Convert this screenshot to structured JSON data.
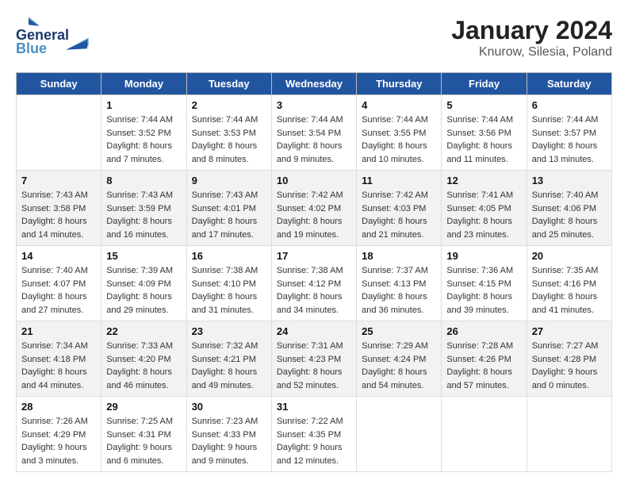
{
  "header": {
    "logo_line1": "General",
    "logo_line2": "Blue",
    "title": "January 2024",
    "subtitle": "Knurow, Silesia, Poland"
  },
  "weekdays": [
    "Sunday",
    "Monday",
    "Tuesday",
    "Wednesday",
    "Thursday",
    "Friday",
    "Saturday"
  ],
  "weeks": [
    [
      {
        "day": "",
        "detail": ""
      },
      {
        "day": "1",
        "detail": "Sunrise: 7:44 AM\nSunset: 3:52 PM\nDaylight: 8 hours\nand 7 minutes."
      },
      {
        "day": "2",
        "detail": "Sunrise: 7:44 AM\nSunset: 3:53 PM\nDaylight: 8 hours\nand 8 minutes."
      },
      {
        "day": "3",
        "detail": "Sunrise: 7:44 AM\nSunset: 3:54 PM\nDaylight: 8 hours\nand 9 minutes."
      },
      {
        "day": "4",
        "detail": "Sunrise: 7:44 AM\nSunset: 3:55 PM\nDaylight: 8 hours\nand 10 minutes."
      },
      {
        "day": "5",
        "detail": "Sunrise: 7:44 AM\nSunset: 3:56 PM\nDaylight: 8 hours\nand 11 minutes."
      },
      {
        "day": "6",
        "detail": "Sunrise: 7:44 AM\nSunset: 3:57 PM\nDaylight: 8 hours\nand 13 minutes."
      }
    ],
    [
      {
        "day": "7",
        "detail": "Sunrise: 7:43 AM\nSunset: 3:58 PM\nDaylight: 8 hours\nand 14 minutes."
      },
      {
        "day": "8",
        "detail": "Sunrise: 7:43 AM\nSunset: 3:59 PM\nDaylight: 8 hours\nand 16 minutes."
      },
      {
        "day": "9",
        "detail": "Sunrise: 7:43 AM\nSunset: 4:01 PM\nDaylight: 8 hours\nand 17 minutes."
      },
      {
        "day": "10",
        "detail": "Sunrise: 7:42 AM\nSunset: 4:02 PM\nDaylight: 8 hours\nand 19 minutes."
      },
      {
        "day": "11",
        "detail": "Sunrise: 7:42 AM\nSunset: 4:03 PM\nDaylight: 8 hours\nand 21 minutes."
      },
      {
        "day": "12",
        "detail": "Sunrise: 7:41 AM\nSunset: 4:05 PM\nDaylight: 8 hours\nand 23 minutes."
      },
      {
        "day": "13",
        "detail": "Sunrise: 7:40 AM\nSunset: 4:06 PM\nDaylight: 8 hours\nand 25 minutes."
      }
    ],
    [
      {
        "day": "14",
        "detail": "Sunrise: 7:40 AM\nSunset: 4:07 PM\nDaylight: 8 hours\nand 27 minutes."
      },
      {
        "day": "15",
        "detail": "Sunrise: 7:39 AM\nSunset: 4:09 PM\nDaylight: 8 hours\nand 29 minutes."
      },
      {
        "day": "16",
        "detail": "Sunrise: 7:38 AM\nSunset: 4:10 PM\nDaylight: 8 hours\nand 31 minutes."
      },
      {
        "day": "17",
        "detail": "Sunrise: 7:38 AM\nSunset: 4:12 PM\nDaylight: 8 hours\nand 34 minutes."
      },
      {
        "day": "18",
        "detail": "Sunrise: 7:37 AM\nSunset: 4:13 PM\nDaylight: 8 hours\nand 36 minutes."
      },
      {
        "day": "19",
        "detail": "Sunrise: 7:36 AM\nSunset: 4:15 PM\nDaylight: 8 hours\nand 39 minutes."
      },
      {
        "day": "20",
        "detail": "Sunrise: 7:35 AM\nSunset: 4:16 PM\nDaylight: 8 hours\nand 41 minutes."
      }
    ],
    [
      {
        "day": "21",
        "detail": "Sunrise: 7:34 AM\nSunset: 4:18 PM\nDaylight: 8 hours\nand 44 minutes."
      },
      {
        "day": "22",
        "detail": "Sunrise: 7:33 AM\nSunset: 4:20 PM\nDaylight: 8 hours\nand 46 minutes."
      },
      {
        "day": "23",
        "detail": "Sunrise: 7:32 AM\nSunset: 4:21 PM\nDaylight: 8 hours\nand 49 minutes."
      },
      {
        "day": "24",
        "detail": "Sunrise: 7:31 AM\nSunset: 4:23 PM\nDaylight: 8 hours\nand 52 minutes."
      },
      {
        "day": "25",
        "detail": "Sunrise: 7:29 AM\nSunset: 4:24 PM\nDaylight: 8 hours\nand 54 minutes."
      },
      {
        "day": "26",
        "detail": "Sunrise: 7:28 AM\nSunset: 4:26 PM\nDaylight: 8 hours\nand 57 minutes."
      },
      {
        "day": "27",
        "detail": "Sunrise: 7:27 AM\nSunset: 4:28 PM\nDaylight: 9 hours\nand 0 minutes."
      }
    ],
    [
      {
        "day": "28",
        "detail": "Sunrise: 7:26 AM\nSunset: 4:29 PM\nDaylight: 9 hours\nand 3 minutes."
      },
      {
        "day": "29",
        "detail": "Sunrise: 7:25 AM\nSunset: 4:31 PM\nDaylight: 9 hours\nand 6 minutes."
      },
      {
        "day": "30",
        "detail": "Sunrise: 7:23 AM\nSunset: 4:33 PM\nDaylight: 9 hours\nand 9 minutes."
      },
      {
        "day": "31",
        "detail": "Sunrise: 7:22 AM\nSunset: 4:35 PM\nDaylight: 9 hours\nand 12 minutes."
      },
      {
        "day": "",
        "detail": ""
      },
      {
        "day": "",
        "detail": ""
      },
      {
        "day": "",
        "detail": ""
      }
    ]
  ]
}
